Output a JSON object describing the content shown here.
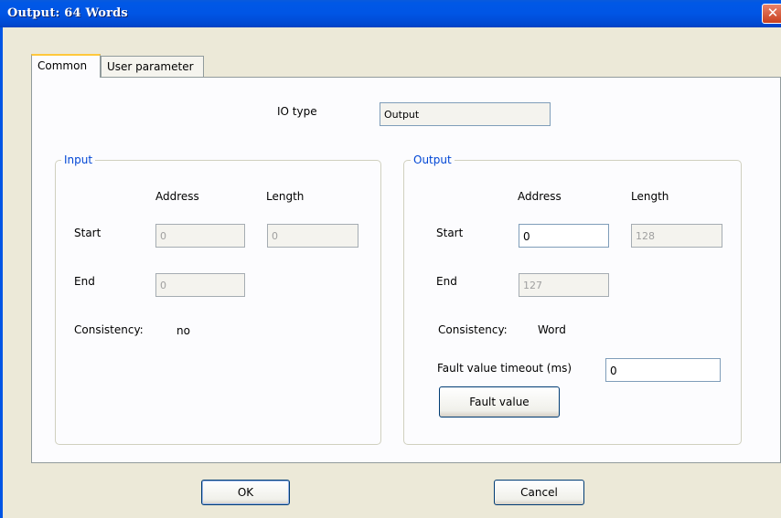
{
  "window": {
    "title": "Output: 64 Words"
  },
  "tabs": [
    {
      "label": "Common",
      "active": true
    },
    {
      "label": "User parameter",
      "active": false
    }
  ],
  "io_type": {
    "label": "IO type",
    "value": "Output"
  },
  "input_group": {
    "title": "Input",
    "address_header": "Address",
    "length_header": "Length",
    "start_label": "Start",
    "end_label": "End",
    "start_address": "0",
    "start_length": "0",
    "end_address": "0",
    "consistency_label": "Consistency:",
    "consistency_value": "no"
  },
  "output_group": {
    "title": "Output",
    "address_header": "Address",
    "length_header": "Length",
    "start_label": "Start",
    "end_label": "End",
    "start_address": "0",
    "start_length": "128",
    "end_address": "127",
    "consistency_label": "Consistency:",
    "consistency_value": "Word",
    "fault_timeout_label": "Fault value timeout (ms)",
    "fault_timeout_value": "0",
    "fault_value_button": "Fault value"
  },
  "buttons": {
    "ok": "OK",
    "cancel": "Cancel"
  },
  "icons": {
    "close": "close-icon"
  },
  "colors": {
    "titlebar": "#0055E5",
    "group_title": "#0046D5",
    "dialog_bg": "#ECE9D8"
  }
}
